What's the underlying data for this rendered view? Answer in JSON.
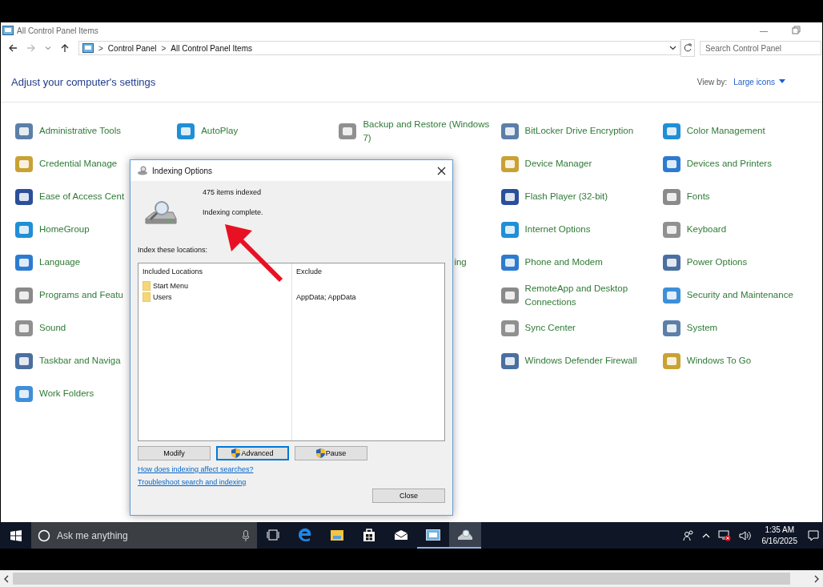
{
  "window": {
    "title": "All Control Panel Items",
    "controls": [
      "—"
    ]
  },
  "address_bar": {
    "crumbs": [
      {
        "sep": ">",
        "label": "Control Panel"
      },
      {
        "sep": ">",
        "label": "All Control Panel Items"
      }
    ]
  },
  "search": {
    "placeholder": "Search Control Panel"
  },
  "heading": "Adjust your computer's settings",
  "view_by": {
    "label": "View by:",
    "value": "Large icons"
  },
  "columns": [
    [
      {
        "label": "Administrative Tools",
        "kind": "item"
      },
      {
        "label": "Credential Manage",
        "kind": "item"
      },
      {
        "label": "Ease of Access Cent",
        "kind": "item"
      },
      {
        "label": "HomeGroup",
        "kind": "item"
      },
      {
        "label": "Language",
        "kind": "item"
      },
      {
        "label": "Programs and Featu",
        "kind": "item"
      },
      {
        "label": "Sound",
        "kind": "item"
      },
      {
        "label": "Taskbar and Naviga",
        "kind": "item"
      },
      {
        "label": "Work Folders",
        "kind": "item"
      }
    ],
    [
      {
        "label": "AutoPlay",
        "kind": "item"
      }
    ],
    [
      {
        "label": "Backup and Restore (Windows 7)",
        "kind": "item"
      },
      {
        "label": "ing",
        "kind": "fragment"
      }
    ],
    [
      {
        "label": "BitLocker Drive Encryption",
        "kind": "item"
      },
      {
        "label": "Device Manager",
        "kind": "item"
      },
      {
        "label": "Flash Player (32-bit)",
        "kind": "item"
      },
      {
        "label": "Internet Options",
        "kind": "item"
      },
      {
        "label": "Phone and Modem",
        "kind": "item"
      },
      {
        "label": "RemoteApp and Desktop Connections",
        "kind": "item"
      },
      {
        "label": "Sync Center",
        "kind": "item"
      },
      {
        "label": "Windows Defender Firewall",
        "kind": "item"
      }
    ],
    [
      {
        "label": "Color Management",
        "kind": "item"
      },
      {
        "label": "Devices and Printers",
        "kind": "item"
      },
      {
        "label": "Fonts",
        "kind": "item"
      },
      {
        "label": "Keyboard",
        "kind": "item"
      },
      {
        "label": "Power Options",
        "kind": "item"
      },
      {
        "label": "Security and Maintenance",
        "kind": "item"
      },
      {
        "label": "System",
        "kind": "item"
      },
      {
        "label": "Windows To Go",
        "kind": "item"
      }
    ]
  ],
  "dialog": {
    "title": "Indexing Options",
    "count": "475 items indexed",
    "status": "Indexing complete.",
    "section_label": "Index these locations:",
    "table": {
      "columns": [
        "Included Locations",
        "Exclude"
      ],
      "rows": [
        {
          "location": "Start Menu",
          "exclude": ""
        },
        {
          "location": "Users",
          "exclude": "AppData; AppData"
        }
      ]
    },
    "buttons": [
      {
        "label": "Modify",
        "shield": false,
        "focused": false
      },
      {
        "label": "Advanced",
        "shield": true,
        "focused": true
      },
      {
        "label": "Pause",
        "shield": true,
        "focused": false
      }
    ],
    "links": [
      "How does indexing affect searches?",
      "Troubleshoot search and indexing"
    ],
    "close_button": "Close"
  },
  "taskbar": {
    "search_placeholder": "Ask me anything",
    "apps": [
      {
        "kind": "taskview",
        "open": false,
        "selected": false
      },
      {
        "kind": "edge",
        "open": false,
        "selected": false
      },
      {
        "kind": "explorer",
        "open": false,
        "selected": false
      },
      {
        "kind": "store",
        "open": false,
        "selected": false
      },
      {
        "kind": "mail",
        "open": false,
        "selected": false
      },
      {
        "kind": "controlpanel",
        "open": true,
        "selected": false
      },
      {
        "kind": "indexing",
        "open": true,
        "selected": true
      }
    ],
    "time": "1:35 AM",
    "date": "6/16/2025"
  }
}
